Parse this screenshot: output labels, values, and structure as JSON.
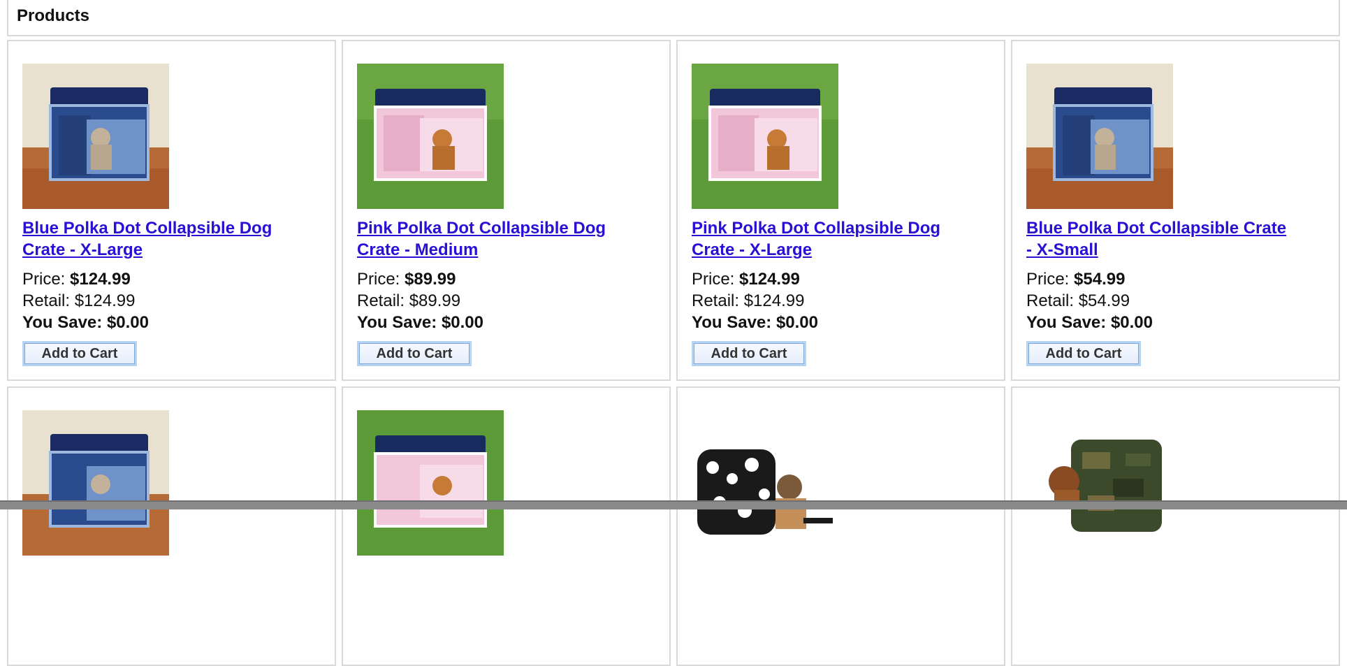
{
  "header": {
    "title": "Products"
  },
  "products": [
    {
      "line1": "Blue Polka Dot Collapsible Dog",
      "line2": "Crate - X-Large",
      "price_label": "Price:",
      "price": "$124.99",
      "retail_label": "Retail:",
      "retail": "$124.99",
      "save_label": "You Save:",
      "save": "$0.00",
      "button": "Add to Cart",
      "image": "blue-crate-dog-indoor"
    },
    {
      "line1": "Pink Polka Dot Collapsible Dog",
      "line2": "Crate - Medium",
      "price_label": "Price:",
      "price": "$89.99",
      "retail_label": "Retail:",
      "retail": "$89.99",
      "save_label": "You Save:",
      "save": "$0.00",
      "button": "Add to Cart",
      "image": "pink-crate-dog-grass"
    },
    {
      "line1": "Pink Polka Dot Collapsible Dog",
      "line2": "Crate - X-Large",
      "price_label": "Price:",
      "price": "$124.99",
      "retail_label": "Retail:",
      "retail": "$124.99",
      "save_label": "You Save:",
      "save": "$0.00",
      "button": "Add to Cart",
      "image": "pink-crate-dog-grass"
    },
    {
      "line1": "Blue Polka Dot Collapsible Crate",
      "line2": "- X-Small",
      "price_label": "Price:",
      "price": "$54.99",
      "retail_label": "Retail:",
      "retail": "$54.99",
      "save_label": "You Save:",
      "save": "$0.00",
      "button": "Add to Cart",
      "image": "blue-crate-dog-indoor"
    }
  ],
  "row2_images": [
    "blue-crate-dog-indoor",
    "pink-crate-dog-grass",
    "animal-print-carrier-dog",
    "camo-carrier-dog"
  ]
}
